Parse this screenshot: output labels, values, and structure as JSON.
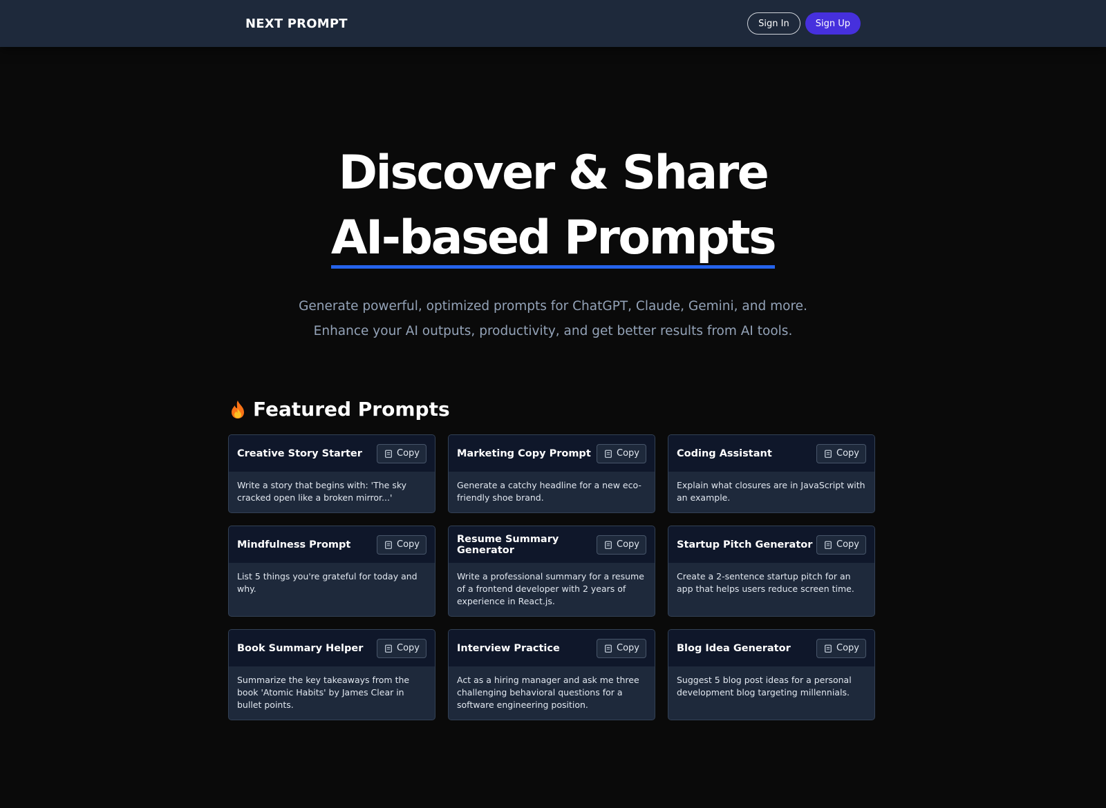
{
  "nav": {
    "brand": "NEXT PROMPT",
    "sign_in": "Sign In",
    "sign_up": "Sign Up"
  },
  "hero": {
    "title_line1": "Discover & Share",
    "title_line2": "AI-based Prompts",
    "subtitle": "Generate powerful, optimized prompts for ChatGPT, Claude, Gemini, and more. Enhance your AI outputs, productivity, and get better results from AI tools."
  },
  "featured": {
    "heading": "Featured Prompts",
    "icon": "fire-icon",
    "copy_label": "Copy",
    "cards": [
      {
        "title": "Creative Story Starter",
        "body": "Write a story that begins with: 'The sky cracked open like a broken mirror...'"
      },
      {
        "title": "Marketing Copy Prompt",
        "body": "Generate a catchy headline for a new eco-friendly shoe brand."
      },
      {
        "title": "Coding Assistant",
        "body": "Explain what closures are in JavaScript with an example."
      },
      {
        "title": "Mindfulness Prompt",
        "body": "List 5 things you're grateful for today and why."
      },
      {
        "title": "Resume Summary Generator",
        "body": "Write a professional summary for a resume of a frontend developer with 2 years of experience in React.js."
      },
      {
        "title": "Startup Pitch Generator",
        "body": "Create a 2-sentence startup pitch for an app that helps users reduce screen time."
      },
      {
        "title": "Book Summary Helper",
        "body": "Summarize the key takeaways from the book 'Atomic Habits' by James Clear in bullet points."
      },
      {
        "title": "Interview Practice",
        "body": "Act as a hiring manager and ask me three challenging behavioral questions for a software engineering position."
      },
      {
        "title": "Blog Idea Generator",
        "body": "Suggest 5 blog post ideas for a personal development blog targeting millennials."
      }
    ]
  },
  "colors": {
    "background": "#0a0a0a",
    "navbar": "#1e293b",
    "accent": "#4630dd",
    "underline": "#2563eb",
    "card": "#1e293b",
    "card_header": "#0f172a",
    "muted_text": "#94a3b8"
  }
}
